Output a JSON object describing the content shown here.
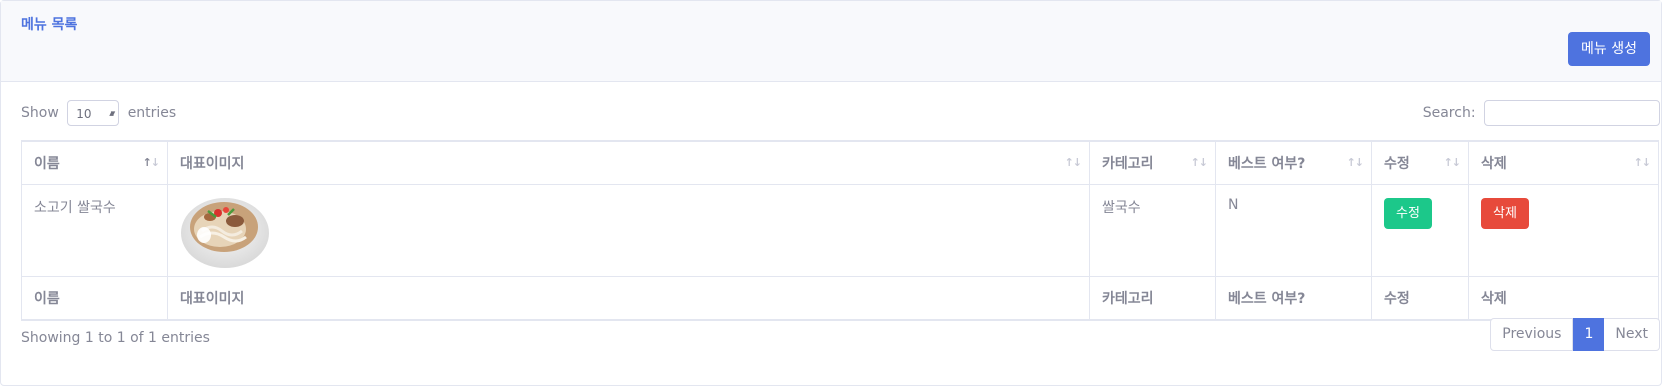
{
  "header": {
    "title": "메뉴 목록",
    "create_button": "메뉴 생성"
  },
  "controls": {
    "show_prefix": "Show",
    "page_length": "10",
    "show_suffix": "entries",
    "search_label": "Search:",
    "search_value": ""
  },
  "table": {
    "columns": [
      "이름",
      "대표이미지",
      "카테고리",
      "베스트 여부?",
      "수정",
      "삭제"
    ],
    "rows": [
      {
        "name": "소고기 쌀국수",
        "image": "beef-pho-bowl-image",
        "category": "쌀국수",
        "best": "N",
        "edit_label": "수정",
        "delete_label": "삭제"
      }
    ]
  },
  "footer": {
    "info": "Showing 1 to 1 of 1 entries",
    "pagination": {
      "previous": "Previous",
      "current": "1",
      "next": "Next"
    }
  },
  "colors": {
    "primary": "#4e73df",
    "success": "#1cc88a",
    "danger": "#e74a3b",
    "text": "#858796"
  }
}
